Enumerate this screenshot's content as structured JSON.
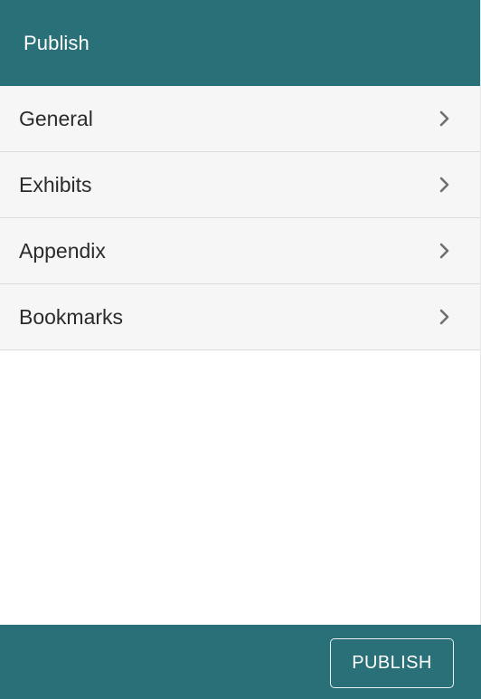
{
  "header": {
    "title": "Publish"
  },
  "menu": {
    "items": [
      {
        "label": "General",
        "icon": "chevron-right-icon"
      },
      {
        "label": "Exhibits",
        "icon": "chevron-right-icon"
      },
      {
        "label": "Appendix",
        "icon": "chevron-right-icon"
      },
      {
        "label": "Bookmarks",
        "icon": "chevron-right-icon"
      }
    ]
  },
  "footer": {
    "publish_label": "PUBLISH"
  },
  "colors": {
    "primary": "#2a7078",
    "item_background": "#f6f6f6",
    "divider": "#dcdcdc",
    "chevron": "#6f6f6f"
  }
}
